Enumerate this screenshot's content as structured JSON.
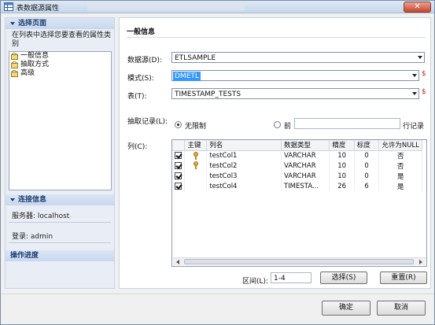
{
  "window": {
    "title": "表数据源属性"
  },
  "left": {
    "select_page_header": "选择页面",
    "select_page_desc": "在列表中选择您要查看的属性类别",
    "pages": [
      {
        "label": "一般信息"
      },
      {
        "label": "抽取方式"
      },
      {
        "label": "高级"
      }
    ],
    "connection_header": "连接信息",
    "server": "服务器: localhost",
    "login": "登录: admin",
    "progress_header": "操作进度"
  },
  "main": {
    "title": "一般信息",
    "datasource_label": "数据源(D):",
    "datasource_value": "ETLSAMPLE",
    "schema_label": "模式(S):",
    "schema_value": "DMETL",
    "table_label": "表(T):",
    "table_value": "TIMESTAMP_TESTS",
    "required_mark": "$",
    "extract_label": "抽取记录(L):",
    "unlimited_label": "无限制",
    "first_label": "前",
    "rows_suffix": "行记录",
    "first_value": "",
    "columns_label": "列(C):",
    "columns": {
      "headers": [
        "",
        "主键",
        "列名",
        "数据类型",
        "精度",
        "标度",
        "允许为NULL"
      ],
      "rows": [
        {
          "checked": true,
          "key": true,
          "name": "testCol1",
          "type": "VARCHAR",
          "precision": "10",
          "scale": "0",
          "nullable": "否"
        },
        {
          "checked": true,
          "key": true,
          "name": "testCol2",
          "type": "VARCHAR",
          "precision": "10",
          "scale": "0",
          "nullable": "否"
        },
        {
          "checked": true,
          "key": false,
          "name": "testCol3",
          "type": "VARCHAR",
          "precision": "10",
          "scale": "0",
          "nullable": "是"
        },
        {
          "checked": true,
          "key": false,
          "name": "testCol4",
          "type": "TIMESTA...",
          "precision": "26",
          "scale": "6",
          "nullable": "是"
        }
      ]
    },
    "range_label": "区间(L):",
    "range_value": "1-4",
    "select_button": "选择(S)",
    "reset_button": "重置(R)"
  },
  "footer": {
    "ok_button": "确定",
    "cancel_button": "取消"
  },
  "colors": {
    "accent": "#3399ff",
    "required": "#d02020",
    "header_text": "#1c3f74"
  }
}
